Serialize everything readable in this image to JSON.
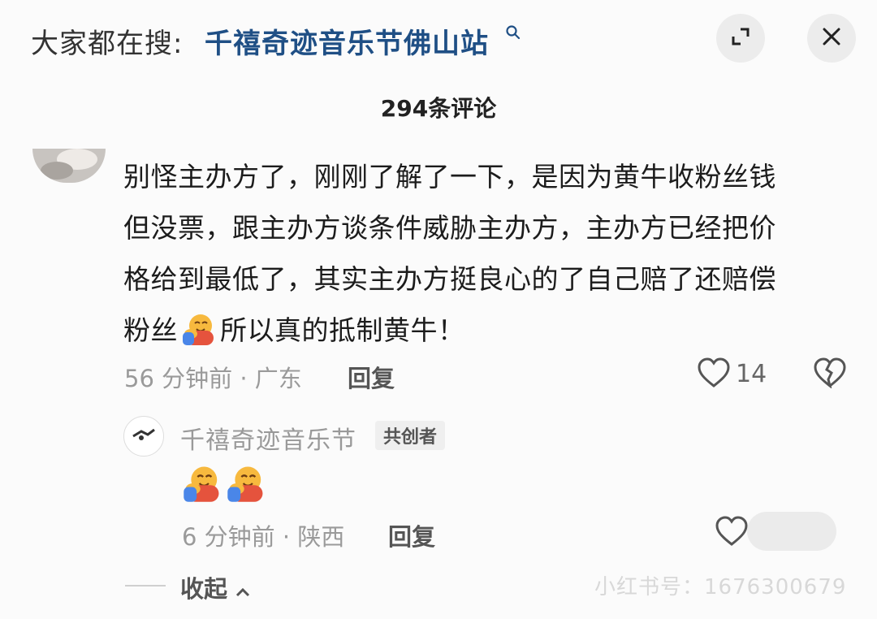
{
  "header": {
    "search_prefix": "大家都在搜:",
    "search_term": "千禧奇迹音乐节佛山站"
  },
  "comment_count": "294条评论",
  "comment": {
    "lines": [
      "别怪主办方了，刚刚了解了一下，是因为黄牛收粉丝钱",
      "但没票，跟主办方谈条件威胁主办方，主办方已经把价",
      "格给到最低了，其实主办方挺良心的了自己赔了还赔偿"
    ],
    "last_line_before_emoji": "粉丝",
    "last_line_after_emoji": "所以真的抵制黄牛！",
    "time_location": "56 分钟前 · 广东",
    "reply_label": "回复",
    "like_count": "14"
  },
  "reply": {
    "author": "千禧奇迹音乐节",
    "badge": "共创者",
    "time_location": "6 分钟前 · 陕西",
    "reply_label": "回复"
  },
  "collapse_label": "收起",
  "watermark": "小红书号：1676300679",
  "colors": {
    "search_term": "#1f4f85",
    "meta_text": "#9a9a9a",
    "background": "#fbfbfb"
  },
  "icons": {
    "search": "magnifier-icon",
    "expand": "expand-icon",
    "close": "close-icon",
    "like": "heart-icon",
    "dislike": "broken-heart-icon",
    "emoji": "hugging-face-emoji"
  }
}
